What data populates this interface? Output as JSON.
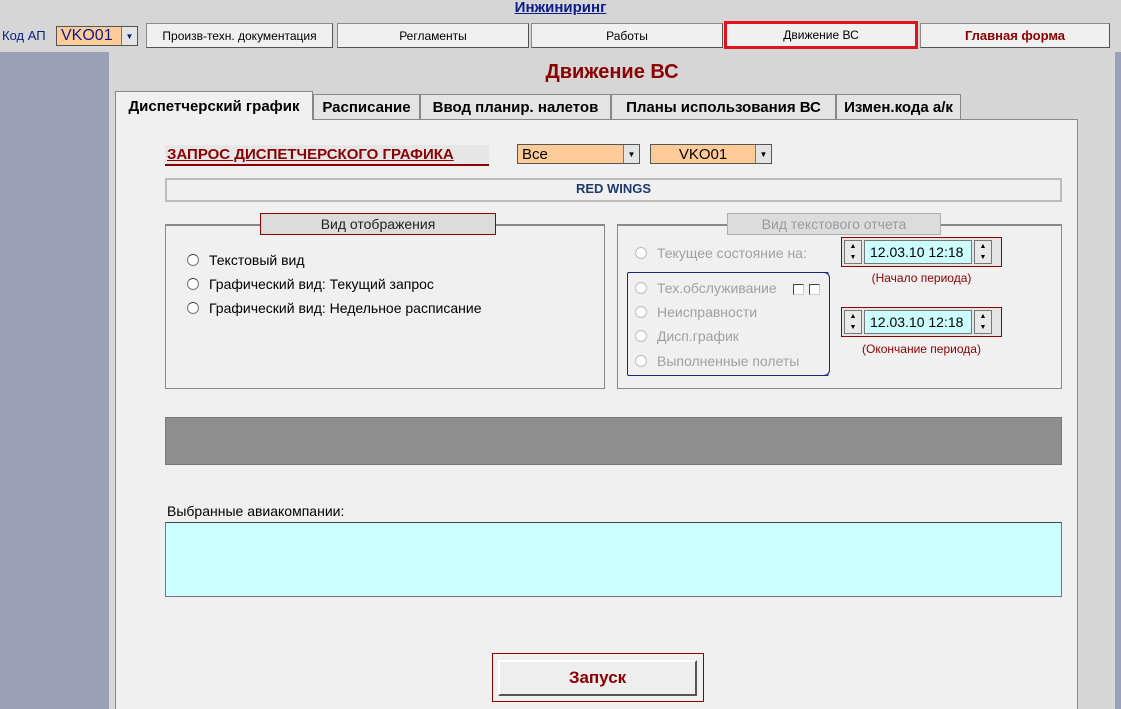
{
  "app": {
    "title": "Инжиниринг"
  },
  "header": {
    "code_label": "Код АП",
    "code_value": "VKO01",
    "nav": {
      "docs": "Произв-техн. документация",
      "regl": "Регламенты",
      "works": "Работы",
      "move": "Движение ВС",
      "main": "Главная форма"
    }
  },
  "page": {
    "title": "Движение ВС"
  },
  "tabs": [
    {
      "label": "Диспетчерский график"
    },
    {
      "label": "Расписание"
    },
    {
      "label": "Ввод планир. налетов"
    },
    {
      "label": "Планы использования ВС"
    },
    {
      "label": "Измен.кода а/к"
    }
  ],
  "query": {
    "label": "ЗАПРОС  ДИСПЕТЧЕРСКОГО  ГРАФИКА",
    "filter_value": "Все",
    "airport_value": "VKO01",
    "airline": "RED WINGS"
  },
  "view_group": {
    "title": "Вид отображения",
    "options": [
      "Текстовый вид",
      "Графический вид: Текущий запрос",
      "Графический вид: Недельное расписание"
    ]
  },
  "text_group": {
    "title": "Вид текстового отчета",
    "current_state": "Текущее состояние на:",
    "options": [
      "Тех.обслуживание",
      "Неисправности",
      "Дисп.график",
      "Выполненные полеты"
    ],
    "start": {
      "value": "12.03.10 12:18",
      "caption": "(Начало периода)"
    },
    "end": {
      "value": "12.03.10 12:18",
      "caption": "(Окончание периода)"
    }
  },
  "airlines": {
    "label": "Выбранные авиакомпании:"
  },
  "run": {
    "label": "Запуск"
  }
}
